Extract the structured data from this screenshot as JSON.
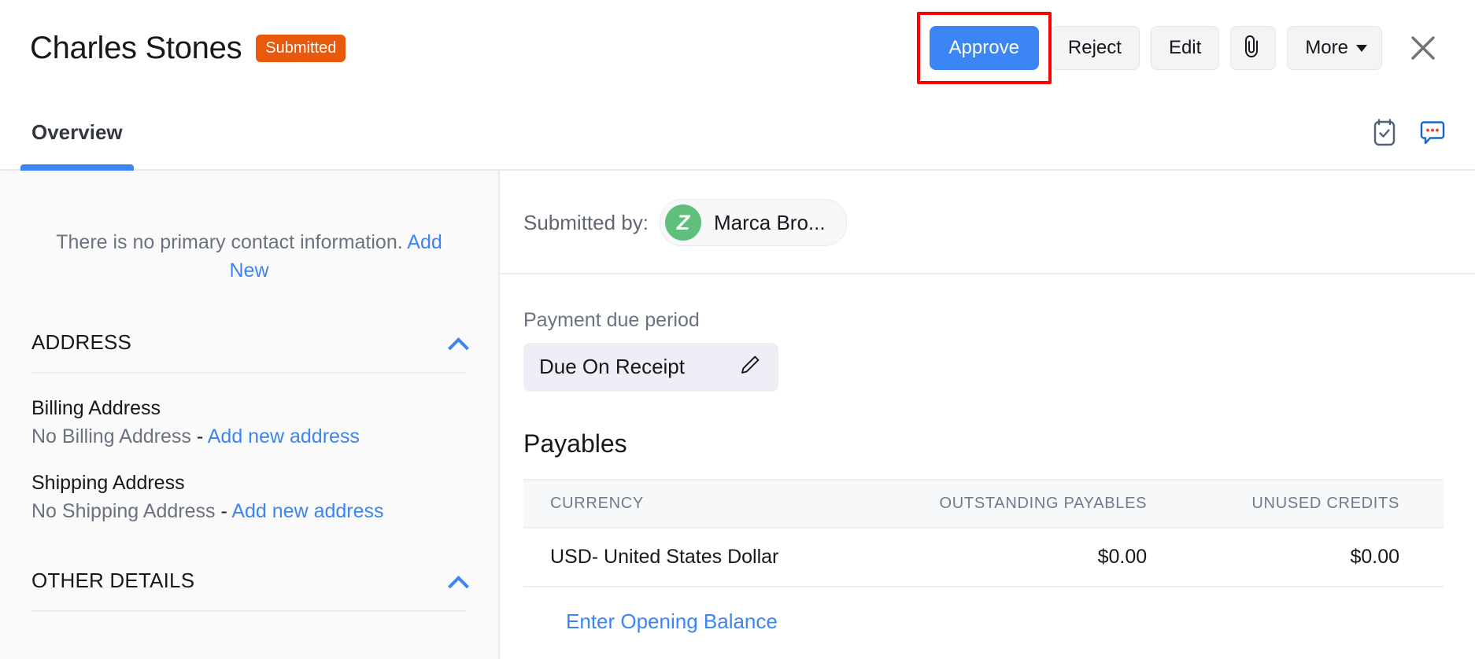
{
  "header": {
    "title": "Charles Stones",
    "status_badge": "Submitted",
    "actions": {
      "approve": "Approve",
      "reject": "Reject",
      "edit": "Edit",
      "attachment_icon": "paperclip-icon",
      "more": "More",
      "close_icon": "close-icon"
    },
    "accent_primary": "#3b85f4",
    "status_color": "#e8590c",
    "highlight_color": "#ff0000"
  },
  "tabs": [
    {
      "label": "Overview",
      "active": true
    }
  ],
  "tab_icons": [
    {
      "name": "tasks-clipboard-icon"
    },
    {
      "name": "comments-icon"
    }
  ],
  "sidebar": {
    "no_contact_text": "There is no primary contact information.",
    "no_contact_link": "Add New",
    "sections": [
      {
        "title": "ADDRESS",
        "collapse_icon": "chevron-up-icon"
      },
      {
        "title": "OTHER DETAILS",
        "collapse_icon": "chevron-up-icon"
      }
    ],
    "addresses": [
      {
        "label": "Billing Address",
        "value": "No Billing Address",
        "separator": "-",
        "link": "Add new address"
      },
      {
        "label": "Shipping Address",
        "value": "No Shipping Address",
        "separator": "-",
        "link": "Add new address"
      }
    ]
  },
  "main": {
    "submitted_by_label": "Submitted by:",
    "submitter": {
      "avatar_initial": "Z",
      "avatar_color": "#5ec07c",
      "name": "Marca Bro..."
    },
    "payment_due": {
      "label": "Payment due period",
      "value": "Due On Receipt",
      "edit_icon": "pencil-icon"
    },
    "payables": {
      "title": "Payables",
      "columns": [
        "CURRENCY",
        "OUTSTANDING PAYABLES",
        "UNUSED CREDITS"
      ],
      "rows": [
        {
          "currency": "USD- United States Dollar",
          "outstanding_payables": "$0.00",
          "unused_credits": "$0.00"
        }
      ],
      "opening_balance_link": "Enter Opening Balance"
    }
  }
}
